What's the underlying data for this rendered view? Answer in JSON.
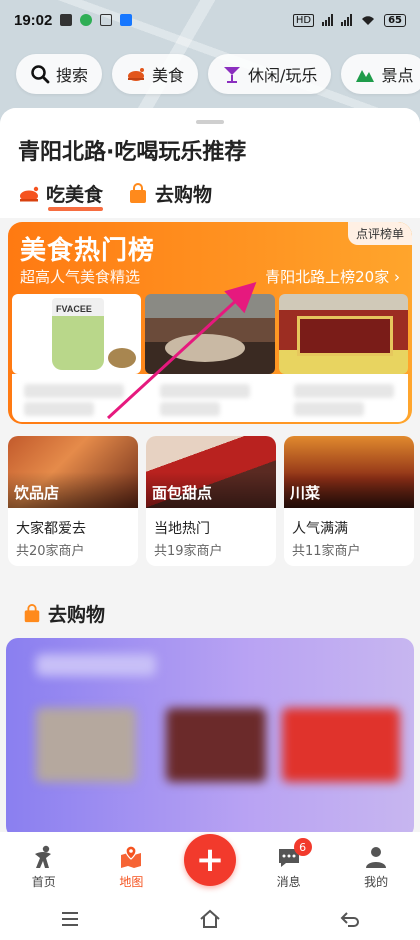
{
  "status_bar": {
    "time": "19:02",
    "battery": "65"
  },
  "chips": [
    {
      "label": "搜索",
      "icon": "search-icon"
    },
    {
      "label": "美食",
      "icon": "food-icon"
    },
    {
      "label": "休闲/玩乐",
      "icon": "cocktail-icon"
    },
    {
      "label": "景点",
      "icon": "mountain-icon"
    }
  ],
  "sheet": {
    "title": "青阳北路·吃喝玩乐推荐",
    "tabs": [
      {
        "label": "吃美食",
        "active": true
      },
      {
        "label": "去购物",
        "active": false
      }
    ]
  },
  "hot_card": {
    "title": "美食热门榜",
    "subtitle": "超高人气美食精选",
    "badge": "点评榜单",
    "link": "青阳北路上榜20家 ›",
    "photo1_label": "FVACEE"
  },
  "categories": [
    {
      "tag": "饮品店",
      "desc": "大家都爱去",
      "count": "共20家商户"
    },
    {
      "tag": "面包甜点",
      "desc": "当地热门",
      "count": "共19家商户"
    },
    {
      "tag": "川菜",
      "desc": "人气满满",
      "count": "共11家商户"
    }
  ],
  "shopping": {
    "title": "去购物"
  },
  "bottom_nav": {
    "items": [
      {
        "label": "首页",
        "icon": "home-person-icon"
      },
      {
        "label": "地图",
        "icon": "map-pin-icon",
        "active": true
      },
      {
        "label": "消息",
        "icon": "message-icon",
        "badge": "6"
      },
      {
        "label": "我的",
        "icon": "profile-icon"
      }
    ],
    "fab_label": "+"
  },
  "colors": {
    "accent": "#f5531f",
    "hot_start": "#ff7a12",
    "hot_end": "#ffa52c",
    "arrow": "#e6197e"
  }
}
